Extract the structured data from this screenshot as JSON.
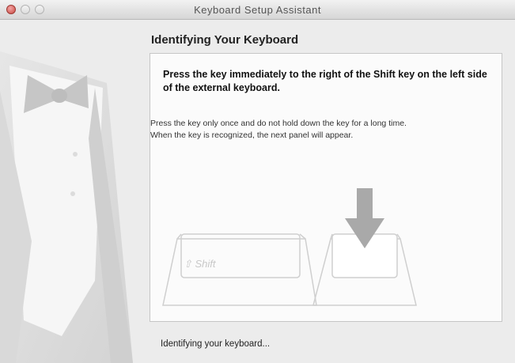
{
  "window": {
    "title": "Keyboard Setup Assistant"
  },
  "page": {
    "heading": "Identifying Your Keyboard"
  },
  "panel": {
    "instruction": "Press the key immediately to the right of the Shift key on the left side of the external keyboard.",
    "note_line1": "Press the key only once and do not hold down the key for a long time.",
    "note_line2": "When the key is recognized, the next panel will appear.",
    "shift_key_label": "⇧ Shift"
  },
  "footer": {
    "status": "Identifying your keyboard..."
  },
  "icons": {
    "close": "close-icon",
    "minimize": "minimize-icon",
    "zoom": "zoom-icon",
    "arrow": "arrow-down-icon"
  },
  "colors": {
    "close_button": "#c9473f",
    "window_bg": "#ececec",
    "arrow": "#a9a9a9"
  }
}
